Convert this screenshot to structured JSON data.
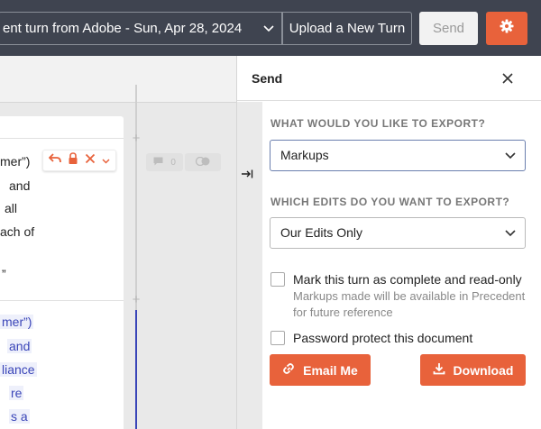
{
  "topbar": {
    "turn_select_value": "ent turn from Adobe - Sun, Apr 28, 2024",
    "upload_label": "Upload a New Turn",
    "send_label": "Send",
    "gear_icon": "gear-icon"
  },
  "document": {
    "top_lines": [
      "mer”)",
      "and",
      "all",
      "ach of",
      "”"
    ],
    "bottom_lines": [
      "mer”)",
      "and",
      "liance",
      "re",
      "s a"
    ],
    "comment_count": "0"
  },
  "panel": {
    "title": "Send",
    "export_question": "WHAT WOULD YOU LIKE TO EXPORT?",
    "export_value": "Markups",
    "edits_question": "WHICH EDITS DO YOU WANT TO EXPORT?",
    "edits_value": "Our Edits Only",
    "complete_label": "Mark this turn as complete and read-only",
    "complete_help": "Markups made will be available in Precedent for future reference",
    "password_label": "Password protect this document",
    "email_label": "Email Me",
    "download_label": "Download"
  },
  "colors": {
    "accent": "#e8623b",
    "topbar": "#3f4450",
    "insertion": "#3a45b8"
  }
}
